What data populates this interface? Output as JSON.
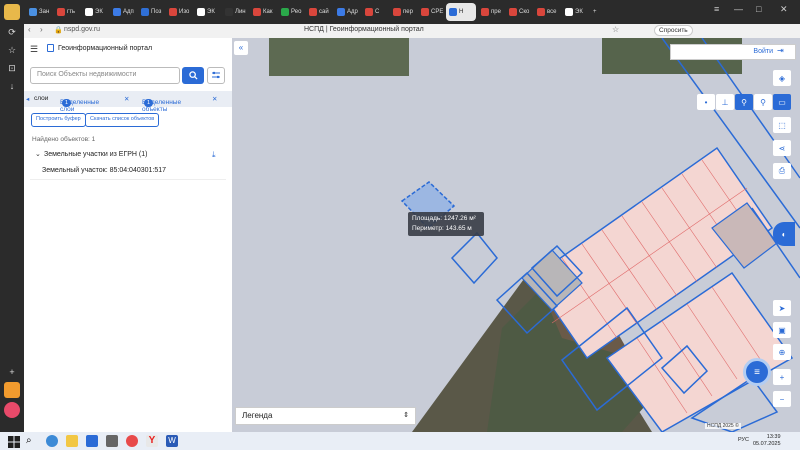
{
  "browser": {
    "url": "nspd.gov.ru",
    "title": "НСПД | Геоинформационный портал",
    "ask_label": "Спросить",
    "tabs": [
      {
        "label": "Зан",
        "color": "#4a90e2"
      },
      {
        "label": "гть",
        "color": "#d9463c"
      },
      {
        "label": "ЭК",
        "color": "#ffffff"
      },
      {
        "label": "Адп",
        "color": "#3c7be6"
      },
      {
        "label": "Поз",
        "color": "#2f6fd6"
      },
      {
        "label": "Изо",
        "color": "#d9463c"
      },
      {
        "label": "ЭК",
        "color": "#ffffff"
      },
      {
        "label": "Лин",
        "color": "#333333"
      },
      {
        "label": "Как",
        "color": "#d9463c"
      },
      {
        "label": "Рео",
        "color": "#2aa84a"
      },
      {
        "label": "сай",
        "color": "#d9463c"
      },
      {
        "label": "Адр",
        "color": "#3c7be6"
      },
      {
        "label": "С",
        "color": "#d9463c"
      },
      {
        "label": "пер",
        "color": "#d9463c"
      },
      {
        "label": "СРЕ",
        "color": "#d9463c"
      },
      {
        "label": "Н",
        "color": "#2b6bd6",
        "active": true
      },
      {
        "label": "пре",
        "color": "#d9463c"
      },
      {
        "label": "Ско",
        "color": "#d9463c"
      },
      {
        "label": "все",
        "color": "#d9463c"
      },
      {
        "label": "ЭК",
        "color": "#ffffff"
      }
    ]
  },
  "panel": {
    "brand": "Геоинформационный портал",
    "search_placeholder": "Поиск Объекты недвижимости",
    "tabs": {
      "layers": "слои",
      "selected_layers": "Выделенные слои",
      "selected_layers_count": "1",
      "selected_objects": "Выделенные объекты",
      "selected_objects_count": "1"
    },
    "buttons": {
      "buffer": "Построить буфер",
      "download_list": "Скачать список объектов"
    },
    "found": "Найдено объектов: 1",
    "group_title": "Земельные участки из ЕГРН (1)",
    "item": "Земельный участок: 85:04:040301:517"
  },
  "map": {
    "login": "Войти",
    "tooltip_area": "Площадь: 1247.26 м²",
    "tooltip_perimeter": "Периметр: 143.65 м",
    "legend": "Легенда",
    "copyright": "НСПД 2025 ©",
    "colors": {
      "accent": "#2b6bd6",
      "parcel_fill": "#f4d6d2",
      "parcel_line": "#e06a6a"
    }
  },
  "taskbar": {
    "lang": "РУС",
    "time": "13:39",
    "date": "05.07.2025"
  }
}
